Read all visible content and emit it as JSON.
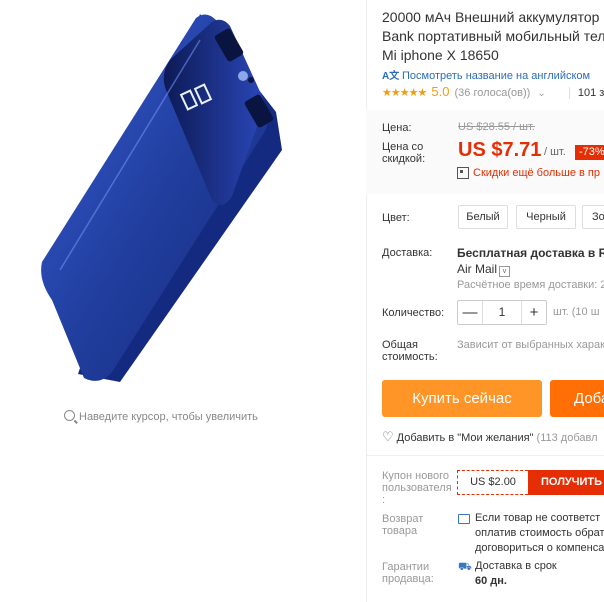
{
  "product": {
    "title_lines": [
      "20000 мАч Внешний аккумулятор п",
      "Bank портативный мобильный теле",
      "Mi iphone X 18650"
    ],
    "translate_link": "Посмотреть название на английском",
    "translate_icon": "translate-icon",
    "stars": "★★★★★",
    "rating": "5.0",
    "votes": "(36 голоса(ов))",
    "orders": "101 за",
    "zoom_hint": "Наведите курсор, чтобы увеличить"
  },
  "price": {
    "label": "Цена:",
    "old": "US $28.55 / шт.",
    "discount_label": "Цена со скидкой:",
    "new": "US $7.71",
    "per": "/ шт.",
    "badge": "-73%",
    "app_discount": "Скидки ещё больше в пр"
  },
  "color": {
    "label": "Цвет:",
    "options": [
      "Белый",
      "Черный",
      "Зо"
    ]
  },
  "shipping": {
    "label": "Доставка:",
    "text": "Бесплатная доставка в Rus",
    "method": "Air Mail",
    "time": "Расчётное время доставки: 2"
  },
  "quantity": {
    "label": "Количество:",
    "value": "1",
    "minus": "—",
    "plus": "+",
    "unit": "шт. (10 ш"
  },
  "total": {
    "label": "Общая стоимость:",
    "value": "Зависит от выбранных харак"
  },
  "actions": {
    "buy": "Купить сейчас",
    "cart": "Доба",
    "wish": "Добавить в \"Мои желания\"",
    "wish_count": "(113 добавл"
  },
  "coupon": {
    "label": "Купон нового пользователя :",
    "amount": "US $2.00",
    "get": "ПОЛУЧИТЬ"
  },
  "returns": {
    "label": "Возврат товара",
    "lines": [
      "Если товар не соответст",
      "оплатив стоимость обрат",
      "договориться о компенса"
    ]
  },
  "guarantee": {
    "label": "Гарантии продавца:",
    "line1": "Доставка в срок",
    "line2": "60 дн."
  },
  "colors": {
    "accent": "#e62e04",
    "buy_button": "#ff9526",
    "cart_button": "#ff6f06",
    "link": "#2e6db4",
    "product_blue": "#1f3d9c"
  }
}
